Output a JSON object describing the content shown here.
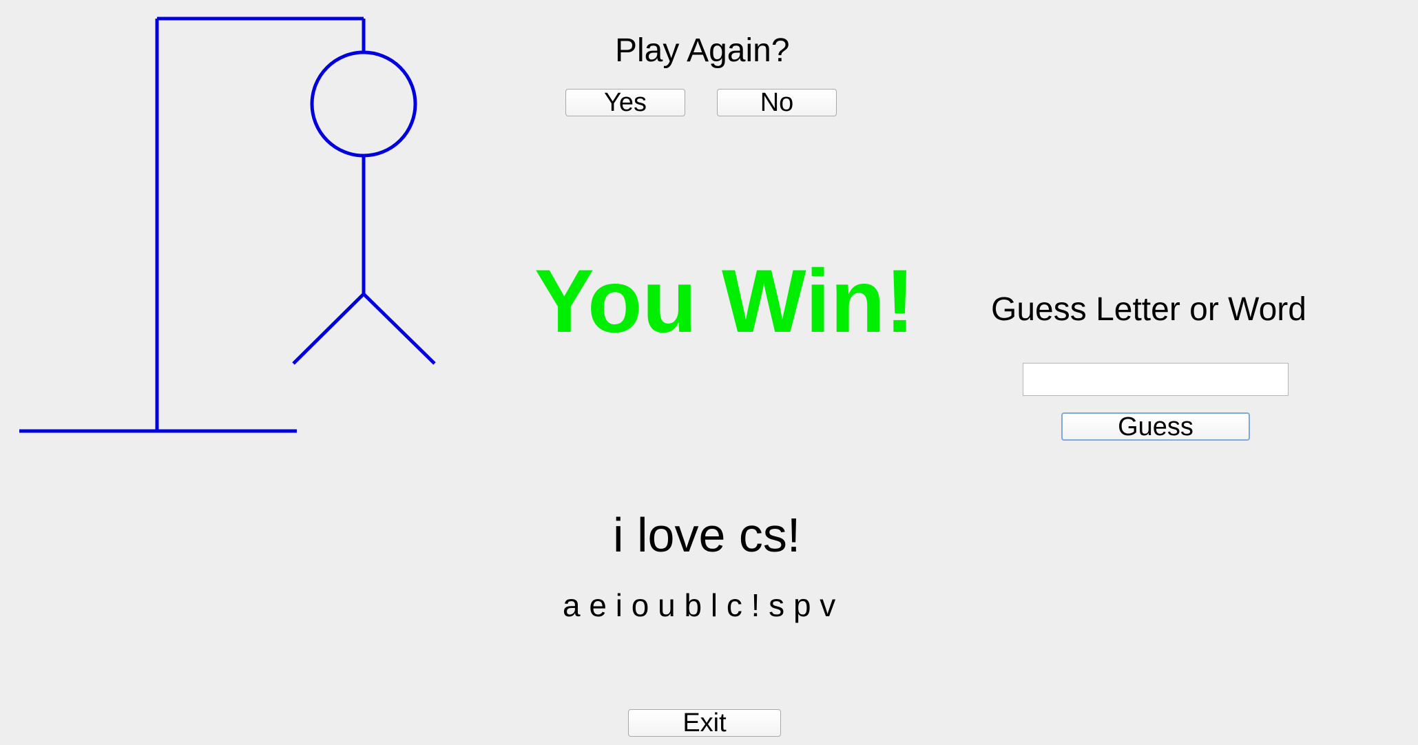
{
  "play_again": {
    "label": "Play Again?",
    "yes_label": "Yes",
    "no_label": "No"
  },
  "result": {
    "text": "You Win!",
    "color": "#00ee00"
  },
  "guess": {
    "prompt": "Guess Letter or Word",
    "input_value": "",
    "button_label": "Guess"
  },
  "word": {
    "display": "i love cs!"
  },
  "guessed_letters": {
    "display": "a e i o u b l c ! s p v"
  },
  "exit": {
    "label": "Exit"
  },
  "colors": {
    "background": "#eeeeee",
    "drawing": "#0000dd"
  }
}
